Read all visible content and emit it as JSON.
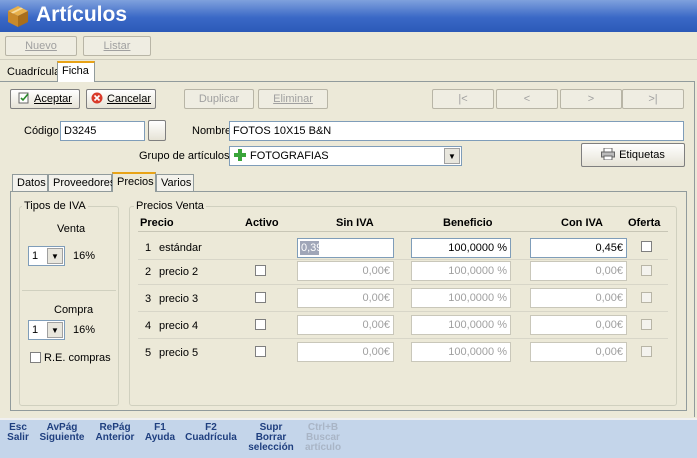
{
  "window": {
    "title": "Artículos"
  },
  "toolbar": {
    "new_label": "Nuevo",
    "list_label": "Listar"
  },
  "view_tabs": [
    {
      "label": "Cuadrícula"
    },
    {
      "label": "Ficha"
    }
  ],
  "actions": {
    "accept_label": "Aceptar",
    "cancel_label": "Cancelar",
    "duplicate_label": "Duplicar",
    "delete_label": "Eliminar",
    "labels_label": "Etiquetas"
  },
  "nav": {
    "first": "|<",
    "prev": "<",
    "next": ">",
    "last": ">|"
  },
  "form": {
    "code_label": "Código",
    "code_value": "D3245",
    "name_label": "Nombre",
    "name_value": "FOTOS 10X15 B&N",
    "group_label": "Grupo de artículos",
    "group_value": "FOTOGRAFIAS"
  },
  "sub_tabs": [
    {
      "label": "Datos"
    },
    {
      "label": "Proveedores"
    },
    {
      "label": "Precios"
    },
    {
      "label": "Varios"
    }
  ],
  "iva": {
    "title": "Tipos de IVA",
    "sale_label": "Venta",
    "sale_type": "1",
    "sale_pct": "16%",
    "purchase_label": "Compra",
    "purchase_type": "1",
    "purchase_pct": "16%",
    "re_label": "R.E. compras"
  },
  "prices": {
    "title": "Precios Venta",
    "headers": {
      "precio": "Precio",
      "activo": "Activo",
      "sin_iva": "Sin IVA",
      "beneficio": "Beneficio",
      "con_iva": "Con IVA",
      "oferta": "Oferta"
    },
    "rows": [
      {
        "num": "1",
        "name": "estándar",
        "sin_iva": "0,39",
        "beneficio": "100,0000 %",
        "con_iva": "0,45€"
      },
      {
        "num": "2",
        "name": "precio 2",
        "sin_iva": "0,00€",
        "beneficio": "100,0000 %",
        "con_iva": "0,00€"
      },
      {
        "num": "3",
        "name": "precio 3",
        "sin_iva": "0,00€",
        "beneficio": "100,0000 %",
        "con_iva": "0,00€"
      },
      {
        "num": "4",
        "name": "precio 4",
        "sin_iva": "0,00€",
        "beneficio": "100,0000 %",
        "con_iva": "0,00€"
      },
      {
        "num": "5",
        "name": "precio 5",
        "sin_iva": "0,00€",
        "beneficio": "100,0000 %",
        "con_iva": "0,00€"
      }
    ]
  },
  "shortcuts": [
    {
      "key": "Esc",
      "desc": "Salir"
    },
    {
      "key": "AvPág",
      "desc": "Siguiente"
    },
    {
      "key": "RePág",
      "desc": "Anterior"
    },
    {
      "key": "F1",
      "desc": "Ayuda"
    },
    {
      "key": "F2",
      "desc": "Cuadrícula"
    },
    {
      "key": "Supr",
      "desc": "Borrar selección"
    },
    {
      "key": "Ctrl+B",
      "desc": "Buscar artículo"
    }
  ]
}
